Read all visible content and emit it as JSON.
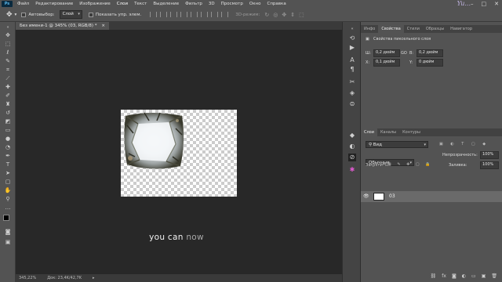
{
  "menubar": {
    "logo": "Ps",
    "items": [
      "Файл",
      "Редактирование",
      "Изображение",
      "Слои",
      "Текст",
      "Выделение",
      "Фильтр",
      "3D",
      "Просмотр",
      "Окно",
      "Справка"
    ],
    "active_index": 3,
    "watermark": "Yu..."
  },
  "options": {
    "autoselect_label": "Автовыбор:",
    "autoselect_value": "Слой",
    "show_controls_label": "Показать упр. элем.",
    "mode3d_label": "3D-режим:"
  },
  "document": {
    "tab_title": "Без имени-1 @ 345% (03, RGB/8) *",
    "caption_bright": "you can",
    "caption_dim": "now"
  },
  "status": {
    "zoom": "345,22%",
    "doc_size": "Док: 23,4K/42,7K"
  },
  "properties": {
    "tabs": [
      "Инфо",
      "Свойства",
      "Стили",
      "Образцы",
      "Навигатор"
    ],
    "active_tab": 1,
    "title": "Свойства пиксельного слоя",
    "w_label": "Ш:",
    "w_value": "0,2 дюйм",
    "link_label": "GO",
    "h_label": "В:",
    "h_value": "0,2 дюйм",
    "x_label": "X:",
    "x_value": "0,1 дюйм",
    "y_label": "Y:",
    "y_value": "0 дюйм"
  },
  "layers": {
    "tabs": [
      "Слои",
      "Каналы",
      "Контуры"
    ],
    "active_tab": 0,
    "filter_label": "Вид",
    "blend_mode": "Обычные",
    "opacity_label": "Непрозрачность:",
    "opacity_value": "100%",
    "lock_label": "Закрепить:",
    "fill_label": "Заливка:",
    "fill_value": "100%",
    "layer_name": "03",
    "bottom_icons": [
      "link-icon",
      "fx-icon",
      "mask-icon",
      "adjust-icon",
      "folder-icon",
      "new-layer-icon",
      "trash-icon"
    ]
  }
}
